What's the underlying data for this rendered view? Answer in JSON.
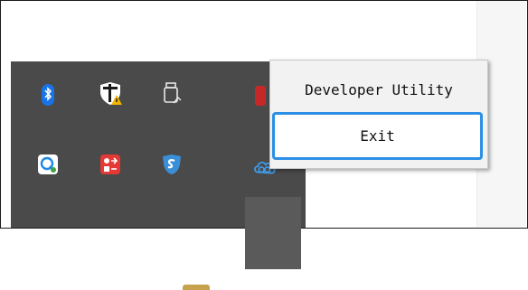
{
  "menu": {
    "items": [
      {
        "label": "Developer Utility"
      },
      {
        "label": "Exit"
      }
    ]
  },
  "tray": {
    "icons": [
      {
        "name": "bluetooth-icon"
      },
      {
        "name": "windows-security-warning-icon"
      },
      {
        "name": "usb-drive-icon"
      },
      {
        "name": "red-app-icon"
      },
      {
        "name": "quick-assist-icon"
      },
      {
        "name": "red-exchange-icon"
      },
      {
        "name": "shield-s-icon"
      },
      {
        "name": "cloud-sync-icon"
      }
    ]
  },
  "colors": {
    "tray_bg": "#4a4a4a",
    "menu_bg": "#f2f2f2",
    "focus_border": "#2b8fe6"
  }
}
